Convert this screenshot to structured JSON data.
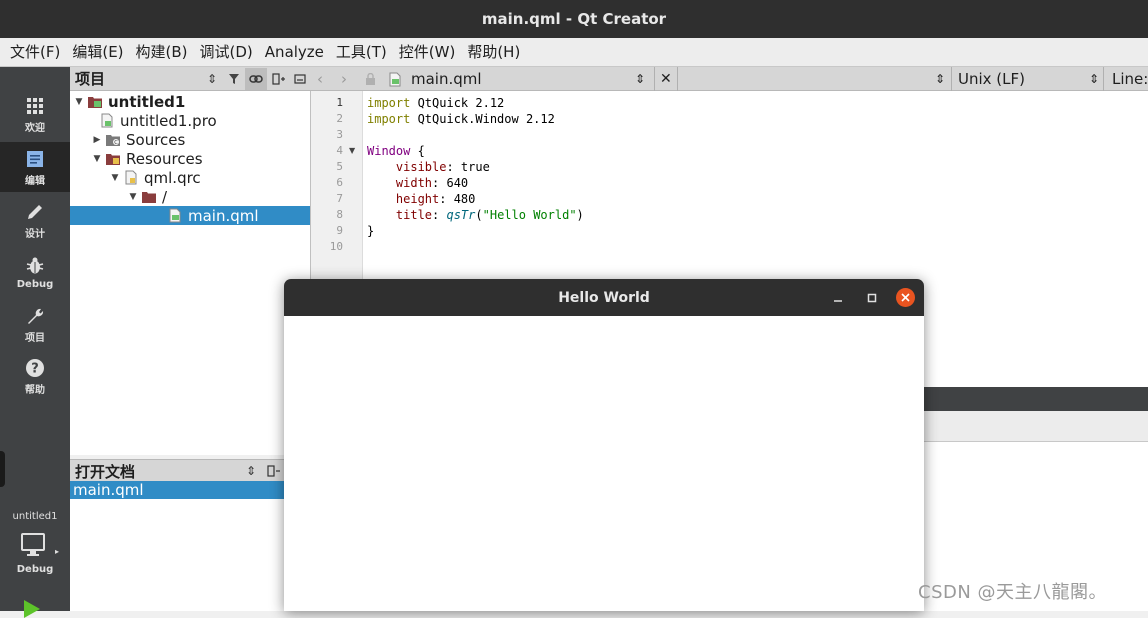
{
  "window": {
    "title": "main.qml - Qt Creator"
  },
  "menu": [
    "文件(F)",
    "编辑(E)",
    "构建(B)",
    "调试(D)",
    "Analyze",
    "工具(T)",
    "控件(W)",
    "帮助(H)"
  ],
  "modes": [
    {
      "label": "欢迎",
      "icon": "grid-icon"
    },
    {
      "label": "编辑",
      "icon": "edit-document-icon"
    },
    {
      "label": "设计",
      "icon": "pencil-icon"
    },
    {
      "label": "Debug",
      "icon": "bug-icon"
    },
    {
      "label": "项目",
      "icon": "wrench-icon"
    },
    {
      "label": "帮助",
      "icon": "help-icon"
    }
  ],
  "kit": {
    "project": "untitled1",
    "mode": "Debug"
  },
  "project_panel": {
    "title": "项目",
    "tree": [
      {
        "label": "untitled1",
        "level": 0,
        "expanded": true
      },
      {
        "label": "untitled1.pro",
        "level": 1
      },
      {
        "label": "Sources",
        "level": 1,
        "expanded": false
      },
      {
        "label": "Resources",
        "level": 1,
        "expanded": true
      },
      {
        "label": "qml.qrc",
        "level": 2,
        "expanded": true
      },
      {
        "label": "/",
        "level": 3,
        "expanded": true
      },
      {
        "label": "main.qml",
        "level": 4,
        "selected": true
      }
    ]
  },
  "open_docs": {
    "title": "打开文档",
    "items": [
      "main.qml"
    ]
  },
  "editor": {
    "file": "main.qml",
    "line_ending": "Unix (LF)",
    "line_label": "Line:",
    "line_numbers": [
      "1",
      "2",
      "3",
      "4",
      "5",
      "6",
      "7",
      "8",
      "9",
      "10"
    ],
    "code": {
      "l1a": "import",
      "l1b": " QtQuick 2.12",
      "l2a": "import",
      "l2b": " QtQuick.Window 2.12",
      "l4a": "Window",
      "l4b": " {",
      "l5a": "    visible",
      "l5b": ": true",
      "l6a": "    width",
      "l6b": ": 640",
      "l7a": "    height",
      "l7b": ": 480",
      "l8a": "    title",
      "l8b": ": ",
      "l8c": "qsTr",
      "l8d": "(",
      "l8e": "\"Hello World\"",
      "l8f": ")",
      "l10": "}"
    }
  },
  "hello_window": {
    "title": "Hello World"
  },
  "watermark": "CSDN @天主八龍閣。",
  "colors": {
    "accent": "#308cc6",
    "keyword": "#808000",
    "type": "#800080",
    "string": "#008000",
    "function": "#00677c"
  }
}
